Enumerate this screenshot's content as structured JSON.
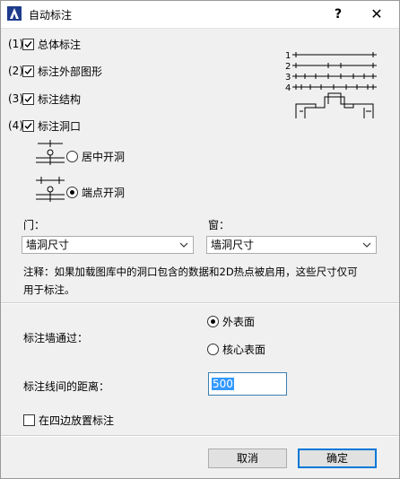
{
  "window": {
    "title": "自动标注",
    "help": "?",
    "close": "✕"
  },
  "options": [
    {
      "num": "(1)",
      "label": "总体标注",
      "checked": true
    },
    {
      "num": "(2)",
      "label": "标注外部图形",
      "checked": true
    },
    {
      "num": "(3)",
      "label": "标注结构",
      "checked": true
    },
    {
      "num": "(4)",
      "label": "标注洞口",
      "checked": true
    }
  ],
  "preview_numbers": [
    "1",
    "2",
    "3",
    "4"
  ],
  "opening_mode": {
    "center_label": "居中开洞",
    "end_label": "端点开洞",
    "selected": "end"
  },
  "door": {
    "label": "门：",
    "value": "墙洞尺寸"
  },
  "window_sel": {
    "label": "窗：",
    "value": "墙洞尺寸"
  },
  "note": {
    "line1": "注释：如果加载图库中的洞口包含的数据和2D热点被启用，这些尺寸仅可",
    "line2": "用于标注。"
  },
  "wall": {
    "label": "标注墙通过：",
    "outer": "外表面",
    "core": "核心表面",
    "selected": "outer"
  },
  "distance": {
    "label": "标注线间的距离：",
    "value": "500"
  },
  "four_sides": {
    "label": "在四边放置标注",
    "checked": false
  },
  "buttons": {
    "cancel": "取消",
    "ok": "确定"
  }
}
